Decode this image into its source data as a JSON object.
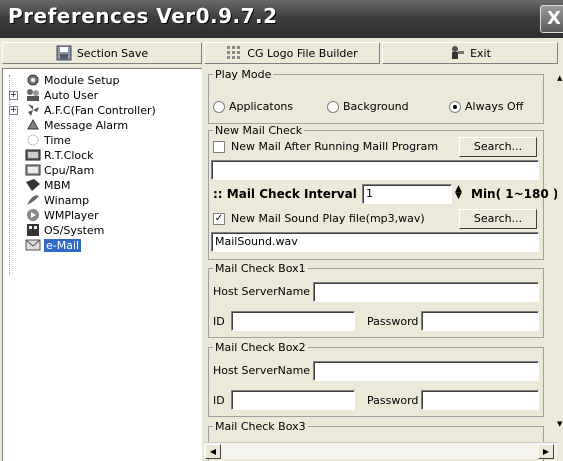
{
  "window": {
    "title": "Preferences Ver0.9.7.2",
    "close_label": "X"
  },
  "toolbar": {
    "section_save": "Section Save",
    "logo_builder": "CG Logo File Builder",
    "exit": "Exit"
  },
  "tree": {
    "items": [
      {
        "label": "Module Setup",
        "icon": "gear-icon",
        "expandable": false
      },
      {
        "label": "Auto User",
        "icon": "users-icon",
        "expandable": true
      },
      {
        "label": "A.F.C(Fan Controller)",
        "icon": "fan-icon",
        "expandable": true
      },
      {
        "label": "Message Alarm",
        "icon": "alarm-icon",
        "expandable": false
      },
      {
        "label": "Time",
        "icon": "clock-icon",
        "expandable": false
      },
      {
        "label": "R.T.Clock",
        "icon": "rtclock-icon",
        "expandable": false
      },
      {
        "label": "Cpu/Ram",
        "icon": "cpu-icon",
        "expandable": false
      },
      {
        "label": "MBM",
        "icon": "mbm-icon",
        "expandable": false
      },
      {
        "label": "Winamp",
        "icon": "winamp-icon",
        "expandable": false
      },
      {
        "label": "WMPlayer",
        "icon": "wmplayer-icon",
        "expandable": false
      },
      {
        "label": "OS/System",
        "icon": "system-icon",
        "expandable": false
      },
      {
        "label": "e-Mail",
        "icon": "mail-icon",
        "expandable": false,
        "selected": true
      }
    ]
  },
  "play_mode": {
    "label": "Play Mode",
    "options": [
      "Applicatons",
      "Background",
      "Always Off"
    ],
    "selected": "Always Off"
  },
  "new_mail_check": {
    "label": "New Mail Check",
    "after_running_label": "New Mail After Running Maill Program",
    "after_running_checked": false,
    "program_path": "",
    "search_label": "Search...",
    "interval_label": ":: Mail Check Interval",
    "interval_value": "1",
    "interval_range": "Min( 1~180 )",
    "sound_label": "New Mail Sound Play file(mp3,wav)",
    "sound_checked": true,
    "sound_file": "MailSound.wav"
  },
  "boxes": [
    {
      "label": "Mail Check Box1",
      "host_label": "Host ServerName",
      "host": "",
      "id_label": "ID",
      "id": "",
      "password_label": "Password",
      "password": ""
    },
    {
      "label": "Mail Check Box2",
      "host_label": "Host ServerName",
      "host": "",
      "id_label": "ID",
      "id": "",
      "password_label": "Password",
      "password": ""
    },
    {
      "label": "Mail Check Box3"
    }
  ],
  "colors": {
    "title_bg": "#3e3e3e",
    "selection": "#316ac5",
    "face": "#ece9d8"
  }
}
